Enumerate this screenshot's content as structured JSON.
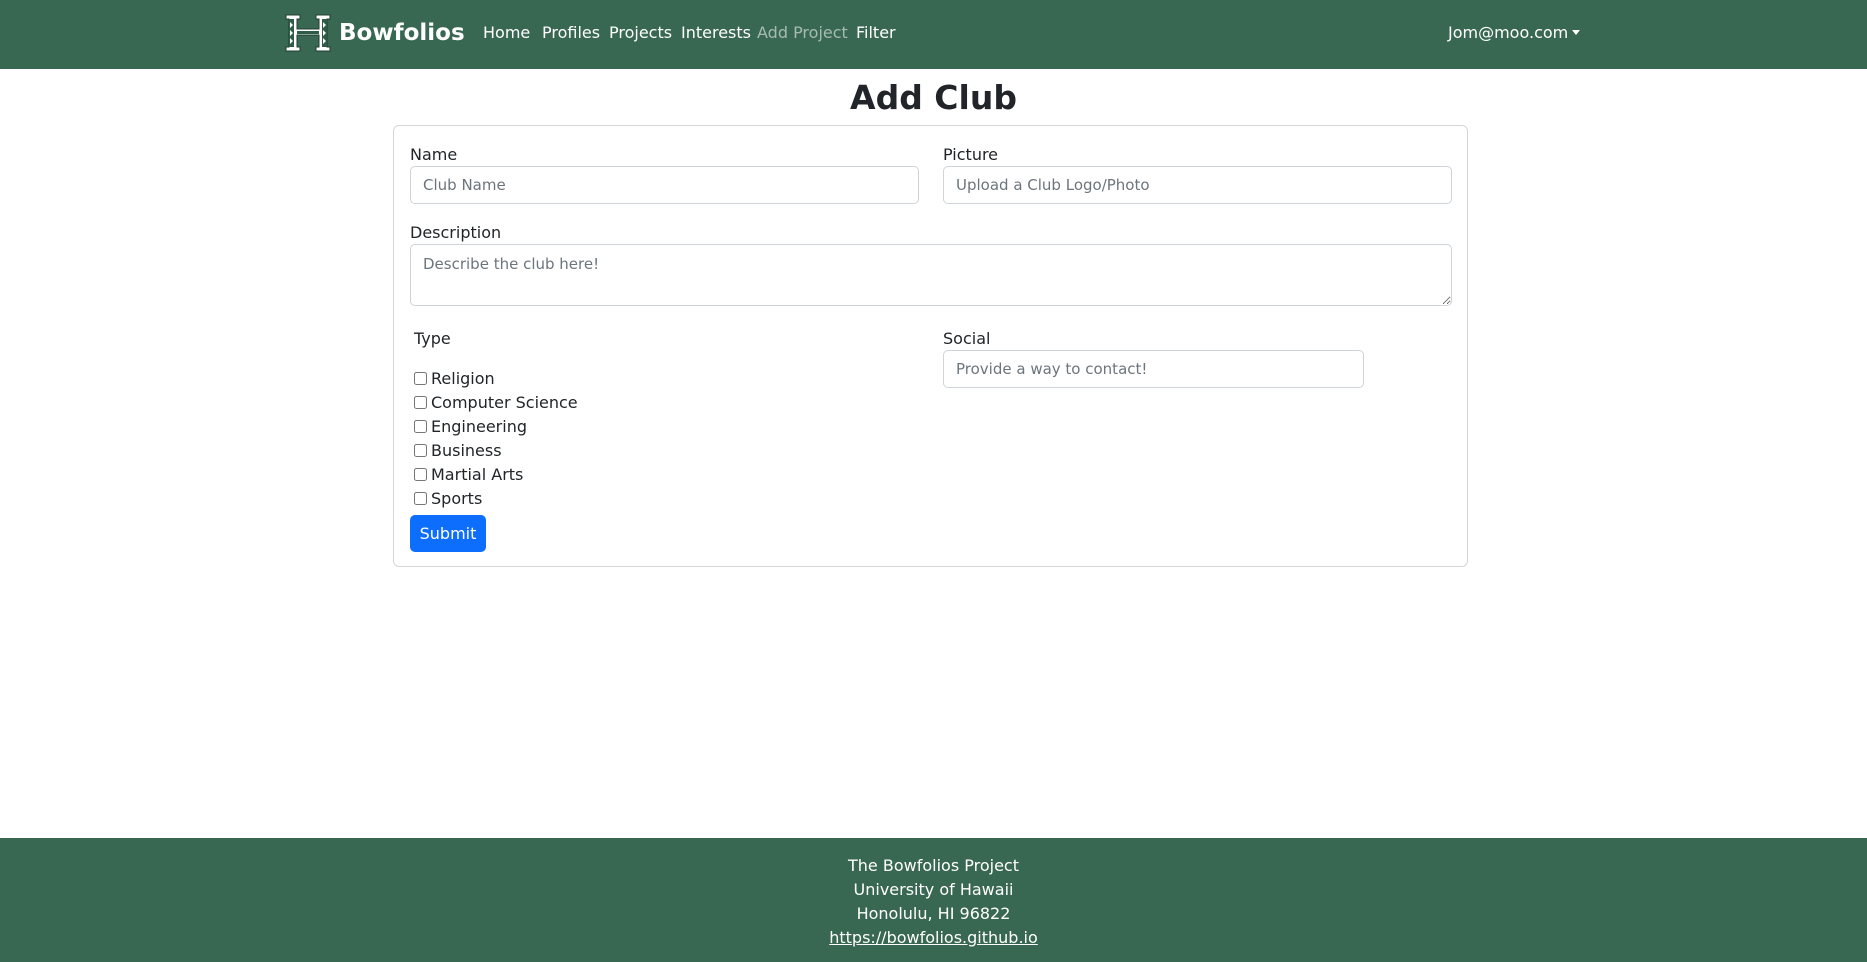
{
  "navbar": {
    "brand": "Bowfolios",
    "logo_icon": "uh-h-logo-icon",
    "links": [
      {
        "label": "Home",
        "active": false
      },
      {
        "label": "Profiles",
        "active": false
      },
      {
        "label": "Projects",
        "active": false
      },
      {
        "label": "Interests",
        "active": false
      },
      {
        "label": "Add Project",
        "active": true
      },
      {
        "label": "Filter",
        "active": false
      }
    ],
    "user": "Jom@moo.com",
    "background": "#386752"
  },
  "form": {
    "title": "Add Club",
    "name": {
      "label": "Name",
      "placeholder": "Club Name",
      "value": ""
    },
    "picture": {
      "label": "Picture",
      "placeholder": "Upload a Club Logo/Photo",
      "value": ""
    },
    "description": {
      "label": "Description",
      "placeholder": "Describe the club here!",
      "value": ""
    },
    "type": {
      "label": "Type",
      "options": [
        {
          "label": "Religion",
          "checked": false
        },
        {
          "label": "Computer Science",
          "checked": false
        },
        {
          "label": "Engineering",
          "checked": false
        },
        {
          "label": "Business",
          "checked": false
        },
        {
          "label": "Martial Arts",
          "checked": false
        },
        {
          "label": "Sports",
          "checked": false
        }
      ]
    },
    "social": {
      "label": "Social",
      "placeholder": "Provide a way to contact!",
      "value": ""
    },
    "submit_label": "Submit",
    "submit_color": "#0d6efd"
  },
  "footer": {
    "lines": [
      "The Bowfolios Project",
      "University of Hawaii",
      "Honolulu, HI 96822"
    ],
    "link": "https://bowfolios.github.io",
    "background": "#386752"
  }
}
